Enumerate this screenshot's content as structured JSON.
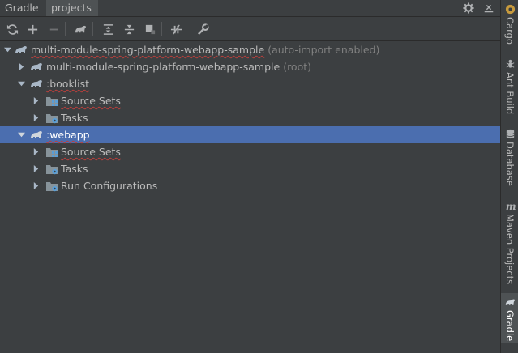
{
  "header": {
    "tabs": [
      {
        "label": "Gradle",
        "active": false
      },
      {
        "label": "projects",
        "active": true
      }
    ],
    "icons": [
      "gear-icon",
      "hide-panel-icon"
    ]
  },
  "toolbar": {
    "buttons": [
      "refresh-icon",
      "add-icon",
      "remove-icon",
      "gradle-task-icon",
      "expand-all-icon",
      "collapse-all-icon",
      "group-modules-icon",
      "toggle-offline-icon",
      "settings-wrench-icon"
    ]
  },
  "tree": {
    "root": {
      "label": "multi-module-spring-platform-webapp-sample",
      "suffix": "(auto-import enabled)"
    },
    "root_module": {
      "label": "multi-module-spring-platform-webapp-sample",
      "suffix": "(root)"
    },
    "booklist": {
      "label": ":booklist",
      "children": [
        {
          "label": "Source Sets"
        },
        {
          "label": "Tasks"
        }
      ]
    },
    "webapp": {
      "label": ":webapp",
      "selected": true,
      "children": [
        {
          "label": "Source Sets"
        },
        {
          "label": "Tasks"
        },
        {
          "label": "Run Configurations"
        }
      ]
    }
  },
  "sidebar": {
    "tools": [
      {
        "label": "Cargo",
        "icon": "cargo-icon"
      },
      {
        "label": "Ant Build",
        "icon": "ant-icon"
      },
      {
        "label": "Database",
        "icon": "database-icon"
      },
      {
        "label": "Maven Projects",
        "icon": "maven-icon"
      },
      {
        "label": "Gradle",
        "icon": "gradle-icon",
        "active": true
      }
    ]
  },
  "colors": {
    "background": "#3c3f41",
    "selection": "#4b6eaf",
    "text": "#bbbbbb",
    "muted": "#808080",
    "folder_blue": "#5a9ed6",
    "squiggle": "#bc3f3c"
  }
}
